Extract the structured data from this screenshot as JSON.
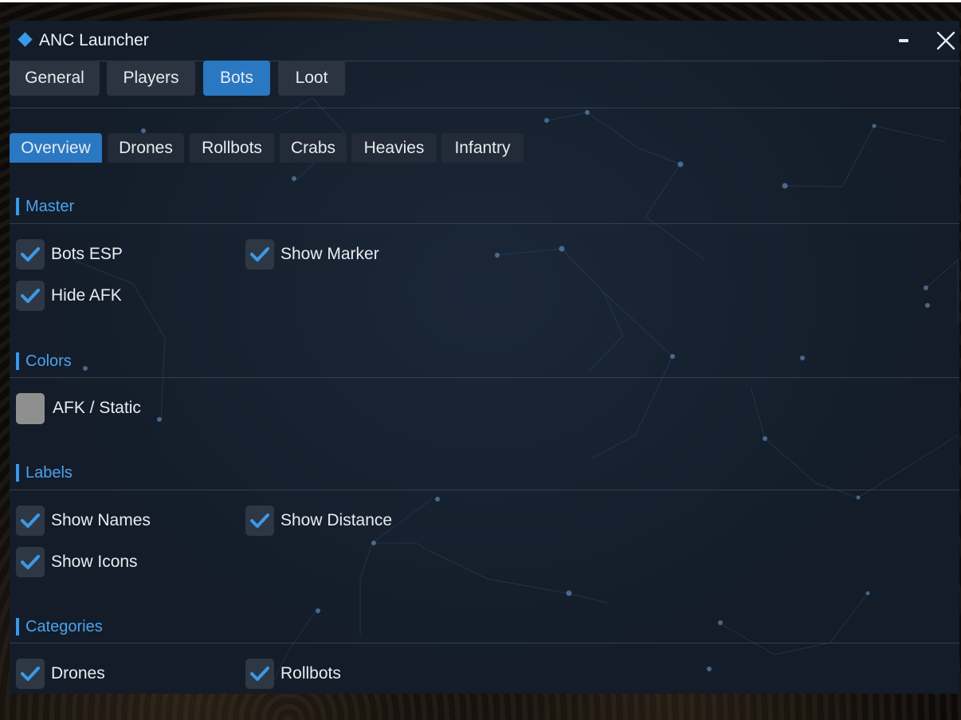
{
  "window": {
    "title": "ANC Launcher",
    "minimize_icon": "minimize-icon",
    "close_icon": "close-icon"
  },
  "main_tabs": [
    {
      "label": "General",
      "active": false
    },
    {
      "label": "Players",
      "active": false
    },
    {
      "label": "Bots",
      "active": true
    },
    {
      "label": "Loot",
      "active": false
    }
  ],
  "sub_tabs": [
    {
      "label": "Overview",
      "active": true
    },
    {
      "label": "Drones",
      "active": false
    },
    {
      "label": "Rollbots",
      "active": false
    },
    {
      "label": "Crabs",
      "active": false
    },
    {
      "label": "Heavies",
      "active": false
    },
    {
      "label": "Infantry",
      "active": false
    }
  ],
  "sections": {
    "master": {
      "title": "Master",
      "items": [
        {
          "label": "Bots ESP",
          "checked": true
        },
        {
          "label": "Show Marker",
          "checked": true
        },
        {
          "label": "Hide AFK",
          "checked": true
        }
      ]
    },
    "colors": {
      "title": "Colors",
      "items": [
        {
          "label": "AFK / Static",
          "color": "#8f8f8f"
        }
      ]
    },
    "labels": {
      "title": "Labels",
      "items": [
        {
          "label": "Show Names",
          "checked": true
        },
        {
          "label": "Show Distance",
          "checked": true
        },
        {
          "label": "Show Icons",
          "checked": true
        }
      ]
    },
    "categories": {
      "title": "Categories",
      "items": [
        {
          "label": "Drones",
          "checked": true
        },
        {
          "label": "Rollbots",
          "checked": true
        }
      ]
    }
  },
  "colors": {
    "accent": "#3b9ae8",
    "active_tab": "#2a78c2",
    "window_bg": "#131c28"
  }
}
